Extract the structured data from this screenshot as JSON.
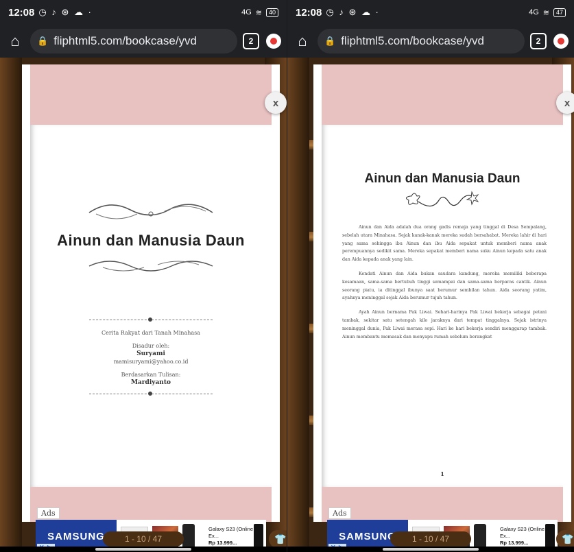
{
  "screens": [
    {
      "status": {
        "time": "12:08",
        "notifications": "◷ ♪ ⊛ ☁ ·",
        "signal": "4G",
        "battery": "40"
      },
      "browser": {
        "url": "fliphtml5.com/bookcase/yvd",
        "tabs": "2"
      },
      "close_label": "x",
      "cover": {
        "title": "Ainun dan Manusia Daun",
        "subtitle": "Cerita Rakyat dari Tanah Minahasa",
        "adapted_by_label": "Disadur oleh:",
        "adapter_name": "Suryami",
        "adapter_email": "mamisuryami@yahoo.co.id",
        "based_on_label": "Berdasarkan Tulisan:",
        "author_name": "Mardiyanto"
      },
      "ads": {
        "label": "Ads",
        "brand": "SAMSUNG",
        "product": "Galaxy S23 (Online Ex...",
        "price": "Rp 13.999..."
      },
      "pager": "1 - 10 / 47"
    },
    {
      "status": {
        "time": "12:08",
        "notifications": "◷ ♪ ⊛ ☁ ·",
        "signal": "4G",
        "battery": "47"
      },
      "browser": {
        "url": "fliphtml5.com/bookcase/yvd",
        "tabs": "2"
      },
      "close_label": "x",
      "story": {
        "title": "Ainun dan Manusia Daun",
        "paragraphs": [
          "Ainun dan Aida adalah dua orang gadis remaja yang tinggal di Desa Sempalang, sebelah utara Minahasa. Sejak kanak-kanak mereka sudah bersahabat. Mereka lahir di hari yang sama sehingga ibu Ainun dan ibu Aida sepakat untuk memberi nama anak perempuannya sedikit sama. Mereka sepakat memberi nama suku Ainun kepada satu anak dan Aida kepada anak yang lain.",
          "Kendati Ainun dan Aida bukan saudara kandung, mereka memiliki beberapa kesamaan, sama-sama bertubuh tinggi semampai dan sama-sama berparas cantik. Ainun seorang piatu, ia ditinggal ibunya saat berumur sembilan tahun. Aida seorang yatim, ayahnya meninggal sejak Aida berumur tujuh tahun.",
          "Ayah Ainun bernama Pak Liwai. Sehari-harinya Pak Liwai bekerja sebagai petani tambak, sekitar satu setengah kilo jaraknya dari tempat tinggalnya. Sejak istrinya meninggal dunia, Pak Liwai merasa sepi. Hari ke hari bekerja sendiri menggarap tambak. Ainun membantu memasak dan menyapu rumah sebelum berangkat"
        ],
        "page_number": "1"
      },
      "ads": {
        "label": "Ads",
        "brand": "SAMSUNG",
        "product": "Galaxy S23 (Online Ex...",
        "price": "Rp 13.999..."
      },
      "pager": "1 - 10 / 47"
    }
  ]
}
